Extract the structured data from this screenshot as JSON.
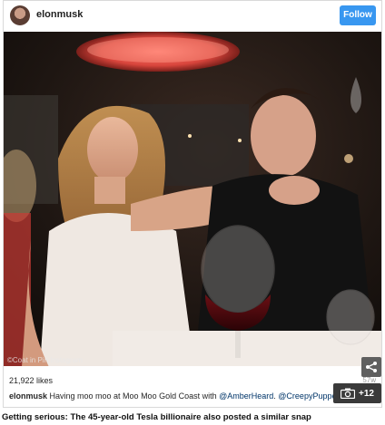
{
  "post": {
    "username": "elonmusk",
    "follow_label": "Follow",
    "likes": "21,922 likes",
    "timestamp": "57w",
    "caption_user": "elonmusk",
    "caption_text": " Having moo moo at Moo Moo Gold Coast with ",
    "mention_1": "@AmberHeard",
    "separator": ". ",
    "mention_2": "@CreepyPuppet",
    "watermark": "©Coat in Pin Instagram"
  },
  "overlay": {
    "share_icon": "share-icon",
    "gallery_icon": "camera-icon",
    "gallery_count": "+12"
  },
  "article": {
    "photo_caption": "Getting serious: The 45-year-old Tesla billionaire also posted a similar snap"
  },
  "colors": {
    "follow_button": "#3897f0",
    "share_button": "#5f5f5f",
    "gallery_button": "#3a3a3a"
  }
}
